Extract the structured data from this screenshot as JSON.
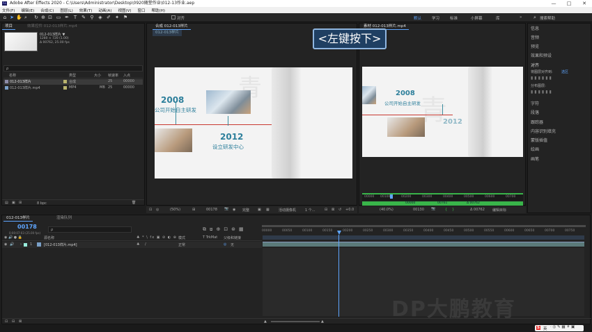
{
  "window": {
    "title": "Adobe After Effects 2020 - C:\\Users\\Administrator\\Desktop\\0920随堂作业\\012-13作业.aep",
    "controls": [
      "—",
      "□",
      "✕"
    ]
  },
  "menu": [
    "文件(F)",
    "编辑(E)",
    "合成(C)",
    "图层(L)",
    "效果(T)",
    "动画(A)",
    "视图(V)",
    "窗口",
    "帮助(H)"
  ],
  "toolbar": {
    "align_label": "对齐",
    "workspaces": [
      "默认",
      "学习",
      "标准",
      "小屏幕",
      "库"
    ],
    "workspace_more": "»",
    "search_placeholder": "搜索帮助"
  },
  "project": {
    "tab_label": "项目",
    "effect_tab": "效果控件 012-013样片.mp4",
    "preview_name": "012-013样片 ▼",
    "preview_size": "1280 × 720 (1.00)",
    "preview_dur": "Δ 00762, 25.00 fps",
    "search_placeholder": "ρ",
    "columns": [
      "名称",
      "类型",
      "大小",
      "帧速率",
      "入点"
    ],
    "rows": [
      {
        "name": "012-013样片",
        "type": "合成",
        "size": "",
        "fps": "25",
        "in": "00000"
      },
      {
        "name": "012-013样片.mp4",
        "type": "MP4",
        "size": "MB",
        "fps": "25",
        "in": "00000"
      }
    ],
    "footer_bpc": "8 bpc"
  },
  "comp_viewer": {
    "tab_label": "合成 012-013样片",
    "breadcrumb": "012-013样片",
    "zoom": "(50%)",
    "time": "00178",
    "res": "完整",
    "camera": "活动摄像机",
    "views": "1 个...",
    "exposure": "+0.0"
  },
  "footage_viewer": {
    "tab_label": "素材 012-013样片.mp4",
    "zoom": "(40.0%)",
    "time": "00130",
    "dur": "Δ 00762",
    "label": "编辑目标",
    "ruler": [
      "00000",
      "00100",
      "00200",
      "00300",
      "00400",
      "00500",
      "00600",
      "00700"
    ],
    "in_label": "00000",
    "out_label": "00761",
    "length_label": "Δ 00762"
  },
  "right_panel": {
    "items": [
      "信息",
      "音频",
      "预览",
      "效果和预设",
      "对齐",
      "将图层对齐到:",
      "",
      "分布图层:",
      "字符",
      "段落",
      "跟踪器",
      "内容识别填充",
      "蒙版插值",
      "绘画",
      "画笔"
    ],
    "align_target": "选区"
  },
  "overlay": {
    "key_hint": "<左键按下>"
  },
  "content": {
    "year1": "2008",
    "text1": "公司开始自主研发",
    "year2": "2012",
    "text2": "设立研发中心",
    "watermark": "DP大鹏教育",
    "ghost": "青"
  },
  "timeline": {
    "tab_label": "012-013样片",
    "render_tab": "渲染队列",
    "timecode": "00178",
    "timecode_sub": "0:00:07:03 (25.00 fps)",
    "search_placeholder": "ρ",
    "columns": [
      "源名称",
      "模式",
      "T TrkMat",
      "父级和链接"
    ],
    "layer": {
      "num": "1",
      "name": "[012-013样片.mp4]",
      "mode": "正常",
      "parent": "无"
    },
    "ruler": [
      "00000",
      "00050",
      "00100",
      "00150",
      "00200",
      "00250",
      "00300",
      "00350",
      "00400",
      "00450",
      "00500",
      "00550",
      "00600",
      "00650",
      "00700",
      "00750"
    ],
    "footer": "切换开关/模式"
  },
  "taskbar": {
    "ime_label": "英"
  }
}
